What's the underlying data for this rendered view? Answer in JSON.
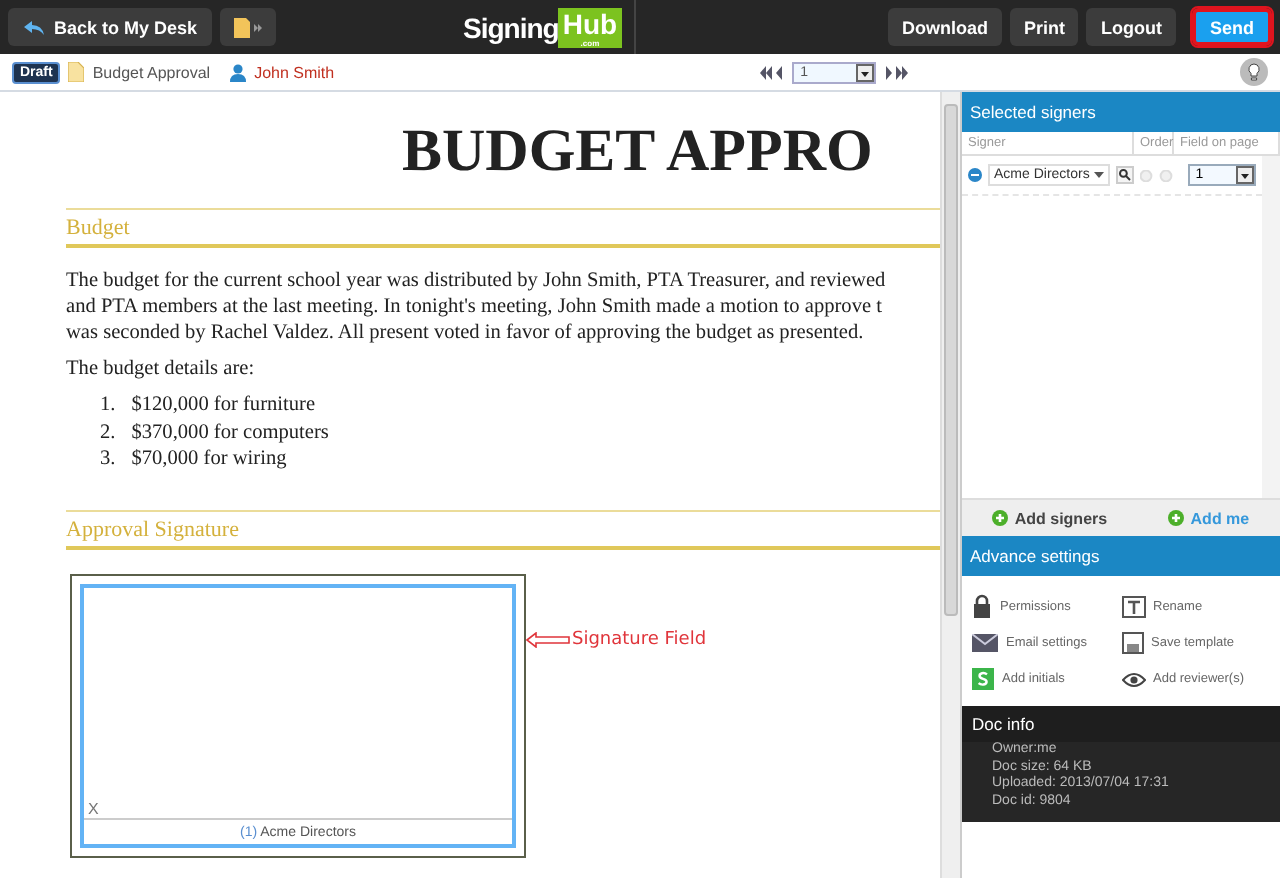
{
  "topbar": {
    "back_button": "Back to My Desk",
    "logo": {
      "part_1": "Signing",
      "part_2": "Hub",
      "tagline": ".com"
    },
    "buttons": [
      {
        "label": "Download",
        "highlighted": false
      },
      {
        "label": "Print",
        "highlighted": false
      },
      {
        "label": "Logout",
        "highlighted": false
      },
      {
        "label": "Send",
        "highlighted": true
      }
    ]
  },
  "docbar": {
    "status_badge": "Draft",
    "document_name": "Budget Approval",
    "owner": "John Smith",
    "page": "1"
  },
  "document": {
    "title": "BUDGET APPRO",
    "sections": [
      {
        "heading": "Budget",
        "paragraph_lines": [
          "The budget for the current school year was distributed by John Smith, PTA Treasurer, and reviewed",
          "and PTA members at the last meeting. In tonight's meeting, John Smith made a motion to approve t",
          "was seconded by Rachel Valdez. All present voted in favor of approving the budget as presented."
        ],
        "intro": "The budget details are:",
        "list": [
          {
            "number": "1.",
            "text": "$120,000 for furniture"
          },
          {
            "number": "2.",
            "text": "$370,000 for computers"
          },
          {
            "number": "3.",
            "text": "$70,000 for wiring"
          }
        ]
      },
      {
        "heading": "Approval Signature",
        "signature_field": {
          "mark": "X",
          "order": "(1)",
          "signer": "Acme Directors",
          "annotation": "Signature Field"
        }
      }
    ]
  },
  "signers_panel": {
    "title": "Selected signers",
    "columns": [
      "Signer",
      "Order",
      "Field on page"
    ],
    "rows": [
      {
        "signer": "Acme Directors",
        "field": "1"
      }
    ],
    "actions": [
      {
        "kind": "add",
        "label": "Add signers"
      },
      {
        "kind": "link",
        "label": "Add me"
      }
    ]
  },
  "advance_settings": {
    "title": "Advance settings",
    "items": [
      {
        "kind": "lock",
        "label": "Permissions"
      },
      {
        "kind": "rename",
        "label": "Rename"
      },
      {
        "kind": "mail",
        "label": "Email settings"
      },
      {
        "kind": "save",
        "label": "Save template"
      },
      {
        "kind": "initials",
        "label": "Add initials"
      },
      {
        "kind": "eye",
        "label": "Add reviewer(s)"
      }
    ]
  },
  "doc_info": {
    "title": "Doc info",
    "lines": [
      "Owner:me",
      "Doc size: 64 KB",
      "Uploaded: 2013/07/04 17:31",
      "Doc id: 9804"
    ]
  }
}
